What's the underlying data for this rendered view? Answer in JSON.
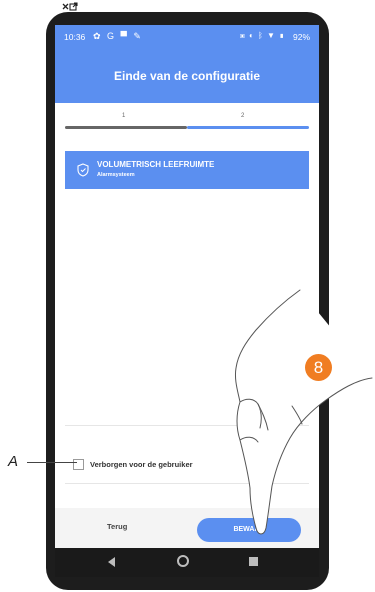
{
  "status_bar": {
    "time": "10:36",
    "battery": "92%",
    "left_icons": "✿ G ▀ ✎",
    "right_icons": "▣ ◐ ᛒ ▼ ▮"
  },
  "header": {
    "title": "Einde van de configuratie"
  },
  "stepper": {
    "steps": [
      {
        "label": "1"
      },
      {
        "label": "2"
      }
    ],
    "current_step": 2,
    "inactive_color": "#666666",
    "active_color": "#5b8ff0"
  },
  "device": {
    "name": "VOLUMETRISCH LEEFRUIMTE",
    "type": "Alarmsysteem",
    "icon": "shield-icon"
  },
  "hidden_option": {
    "label": "Verborgen voor de gebruiker",
    "checked": false
  },
  "footer": {
    "back_label": "Terug",
    "save_label": "BEWAAR"
  },
  "callout": {
    "letter": "A",
    "step_number": "8",
    "badge_color": "#f07d22"
  },
  "colors": {
    "accent": "#5b8ff0"
  }
}
